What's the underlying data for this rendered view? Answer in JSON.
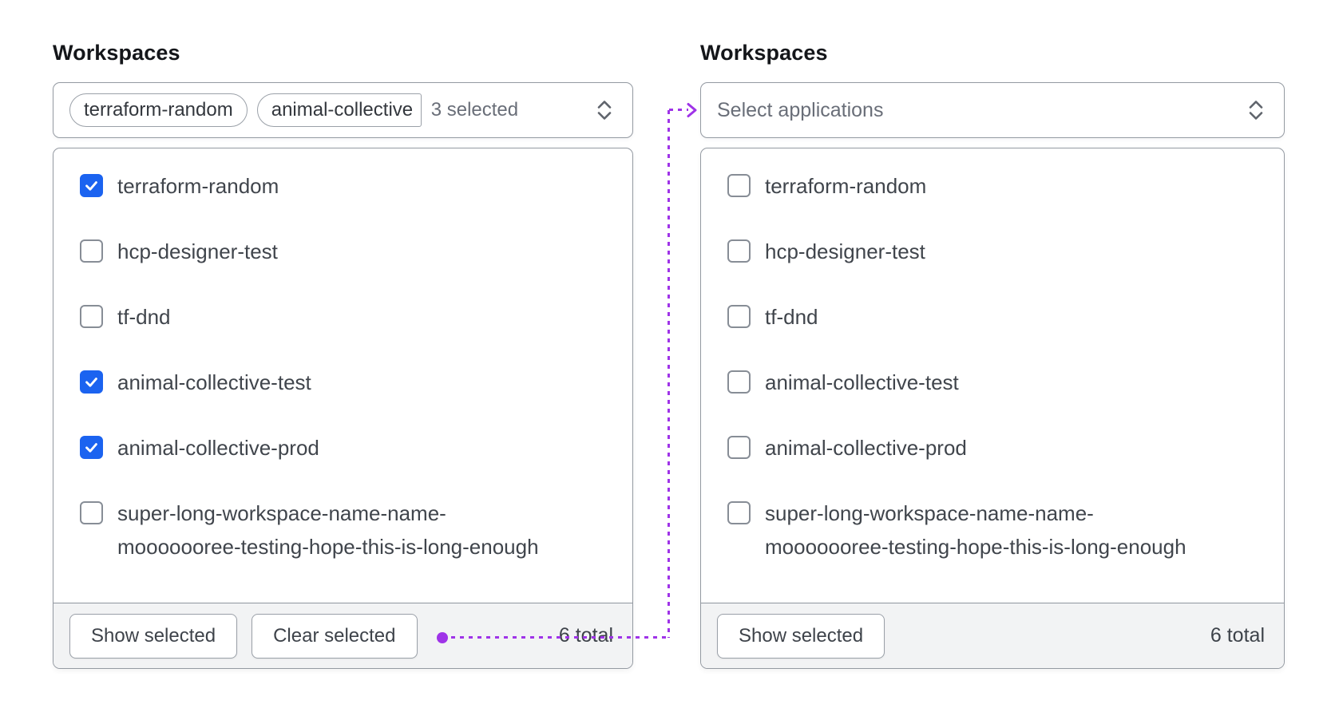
{
  "colors": {
    "accent_blue": "#1b63f0",
    "annotation_purple": "#9f33e8"
  },
  "left": {
    "label": "Workspaces",
    "trigger": {
      "chips": [
        "terraform-random",
        "animal-collective"
      ],
      "count_text": "3 selected",
      "chevron_icon": "chevron-up-down-icon"
    },
    "options": [
      {
        "label": "terraform-random",
        "checked": true
      },
      {
        "label": "hcp-designer-test",
        "checked": false
      },
      {
        "label": "tf-dnd",
        "checked": false
      },
      {
        "label": "animal-collective-test",
        "checked": true
      },
      {
        "label": "animal-collective-prod",
        "checked": true
      },
      {
        "label": "super-long-workspace-name-name-mooooooree-testing-hope-this-is-long-enough",
        "checked": false
      }
    ],
    "footer": {
      "show_button": "Show selected",
      "clear_button": "Clear selected",
      "total": "6 total"
    }
  },
  "right": {
    "label": "Workspaces",
    "trigger": {
      "placeholder": "Select applications",
      "chevron_icon": "chevron-up-down-icon"
    },
    "options": [
      {
        "label": "terraform-random",
        "checked": false
      },
      {
        "label": "hcp-designer-test",
        "checked": false
      },
      {
        "label": "tf-dnd",
        "checked": false
      },
      {
        "label": "animal-collective-test",
        "checked": false
      },
      {
        "label": "animal-collective-prod",
        "checked": false
      },
      {
        "label": "super-long-workspace-name-name-mooooooree-testing-hope-this-is-long-enough",
        "checked": false
      }
    ],
    "footer": {
      "show_button": "Show selected",
      "total": "6 total"
    }
  }
}
